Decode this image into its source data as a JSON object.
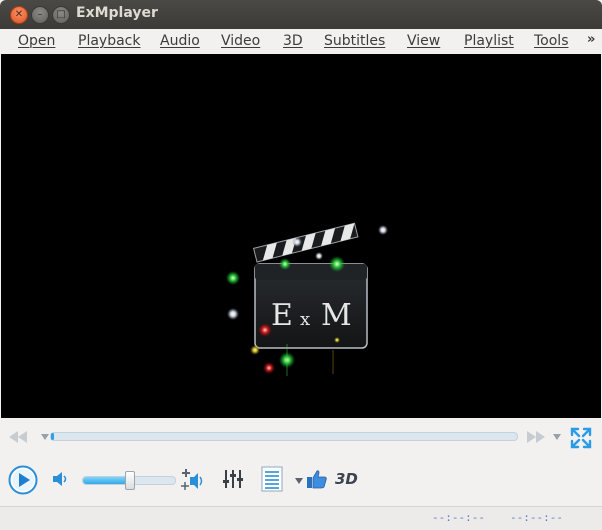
{
  "window": {
    "title": "ExMplayer"
  },
  "menu": {
    "items": [
      {
        "label": "Open"
      },
      {
        "label": "Playback"
      },
      {
        "label": "Audio"
      },
      {
        "label": "Video"
      },
      {
        "label": "3D"
      },
      {
        "label": "Subtitles"
      },
      {
        "label": "View"
      },
      {
        "label": "Playlist"
      },
      {
        "label": "Tools"
      }
    ],
    "more": "»"
  },
  "logo": {
    "left_letter": "E",
    "mid_letter": "x",
    "right_letter": "M"
  },
  "controls": {
    "seek_progress": 0.0,
    "volume_level": 0.5,
    "label_3d": "3D"
  },
  "status": {
    "current_time": "--:--:--",
    "total_time": "--:--:--"
  },
  "colors": {
    "accent": "#2ea0e8",
    "titlebar": "#3c3b37",
    "video_bg": "#000000"
  },
  "icons": [
    "close-icon",
    "minimize-icon",
    "maximize-icon",
    "rewind-icon",
    "forward-icon",
    "fullscreen-icon",
    "play-icon",
    "volume-icon",
    "volume-boost-icon",
    "equalizer-icon",
    "playlist-icon",
    "like-icon"
  ]
}
